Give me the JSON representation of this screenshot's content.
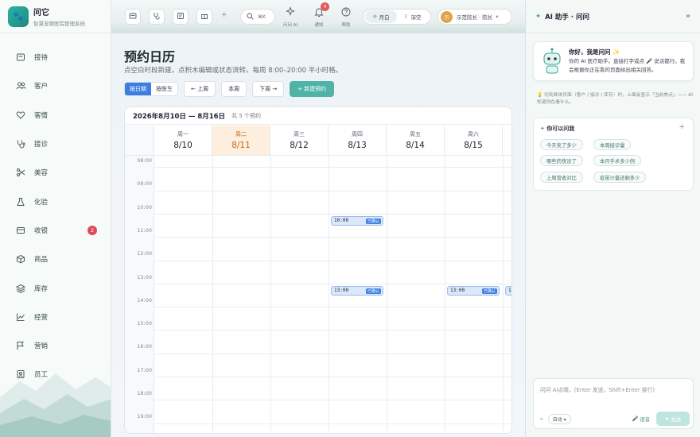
{
  "app": {
    "name": "问它",
    "subtitle": "智慧宠物医院管理系统"
  },
  "sidebar": {
    "items": [
      {
        "label": "接待",
        "icon": "reception-icon"
      },
      {
        "label": "客户",
        "icon": "customers-icon"
      },
      {
        "label": "客情",
        "icon": "heart-icon"
      },
      {
        "label": "接诊",
        "icon": "stethoscope-icon"
      },
      {
        "label": "美容",
        "icon": "scissors-icon"
      },
      {
        "label": "化验",
        "icon": "flask-icon"
      },
      {
        "label": "收银",
        "icon": "cashier-icon",
        "badge": "2"
      },
      {
        "label": "商品",
        "icon": "box-icon"
      },
      {
        "label": "库存",
        "icon": "layers-icon"
      },
      {
        "label": "经营",
        "icon": "chart-icon"
      },
      {
        "label": "营销",
        "icon": "flag-icon"
      },
      {
        "label": "员工",
        "icon": "staff-icon"
      }
    ]
  },
  "topbar": {
    "search_shortcut": "⌘K",
    "ask_ai_label": "问问 AI",
    "notify_label": "通知",
    "notify_count": "4",
    "help_label": "帮助",
    "theme": {
      "light": "月白",
      "dark": "深空"
    },
    "user": {
      "avatar": "示",
      "name": "示范院长 · 院长"
    }
  },
  "page": {
    "title": "预约日历",
    "description": "点空白时段新建，点积木编辑或状态流转。每周 8:00–20:00 半小时格。",
    "view_by_date": "按日期",
    "view_by_doctor": "按医生",
    "prev_week": "← 上周",
    "this_week": "本周",
    "next_week": "下周 →",
    "new_appointment": "+ 新建预约"
  },
  "calendar": {
    "range": "2026年8月10日 — 8月16日",
    "count": "共 5 个预约",
    "days": [
      {
        "weekday": "周一",
        "date": "8/10",
        "today": false
      },
      {
        "weekday": "周二",
        "date": "8/11",
        "today": true
      },
      {
        "weekday": "周三",
        "date": "8/12",
        "today": false
      },
      {
        "weekday": "周四",
        "date": "8/13",
        "today": false
      },
      {
        "weekday": "周五",
        "date": "8/14",
        "today": false
      },
      {
        "weekday": "周六",
        "date": "8/15",
        "today": false
      },
      {
        "weekday": "",
        "date": "",
        "today": false
      }
    ],
    "hours": [
      "08:00",
      "09:00",
      "10:00",
      "11:00",
      "12:00",
      "13:00",
      "14:00",
      "15:00",
      "16:00",
      "17:00",
      "18:00",
      "19:00"
    ],
    "events": [
      {
        "day": 3,
        "time": "10:00",
        "status": "已确认"
      },
      {
        "day": 3,
        "time": "13:00",
        "status": "已确认"
      },
      {
        "day": 5,
        "time": "13:00",
        "status": "已确认"
      },
      {
        "day": 6,
        "time": "13:00",
        "status": ""
      }
    ]
  },
  "ai": {
    "title": "AI 助手 · 问问",
    "welcome_title": "你好，我是问问 ✨",
    "welcome_body": "你的 AI 医疗助手。直接打字或点 🎤 说话都行。我会根据你正在看的页面给出相关回答。",
    "tip": "💡 切到具体页面（客户 / 接诊 / 库存）时，上面会显示「当前焦点」—— AI 知道你在看什么。",
    "suggest_title": "你可以问我",
    "suggestions": [
      "今天卖了多少",
      "本周接诊量",
      "哪些药快没了",
      "本月手术多少例",
      "上周营收对比",
      "疫苗沙量还剩多少"
    ],
    "input_placeholder": "问问 AI点睛，(Enter 发送，Shift+Enter 换行)",
    "auto_label": "自动",
    "voice_label": "语音",
    "send_label": "发送"
  }
}
